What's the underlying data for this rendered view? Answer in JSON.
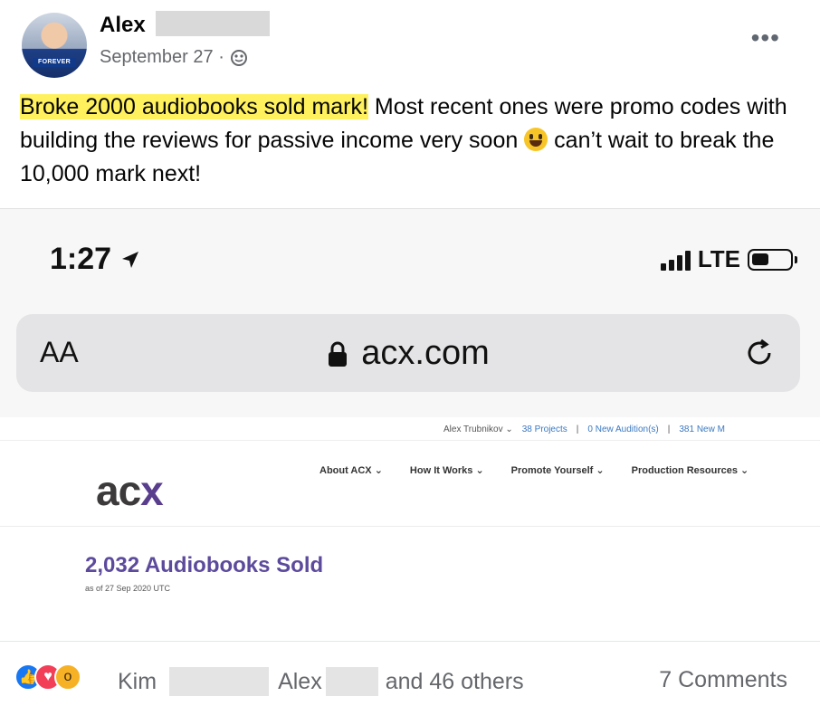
{
  "post": {
    "author": "Alex",
    "date": "September 27 ·",
    "avatar_banner": "FOREVER",
    "text_highlight": "Broke 2000 audiobooks sold mark!",
    "text_rest_1": " Most recent ones were promo codes with building the reviews for passive income very soon ",
    "text_rest_2": " can’t wait to break the 10,000 mark next!"
  },
  "phone": {
    "time": "1:27",
    "network": "LTE",
    "url_aa": "AA",
    "url": "acx.com"
  },
  "site": {
    "topbar_user": "Alex Trubnikov ⌄",
    "topbar_projects": "38 Projects",
    "topbar_auditions": "0 New Audition(s)",
    "topbar_messages": "381 New M",
    "logo_ac": "ac",
    "logo_x": "x",
    "nav": [
      "About ACX ⌄",
      "How It Works ⌄",
      "Promote Yourself ⌄",
      "Production Resources ⌄"
    ],
    "sold_title": "2,032 Audiobooks Sold",
    "sold_date": "as of 27 Sep 2020 UTC"
  },
  "reactions": {
    "name1": "Kim",
    "name2": "Alex",
    "others": "and 46 others",
    "comments": "7 Comments"
  },
  "icons": [
    "globe-icon",
    "more-icon",
    "location-arrow-icon",
    "signal-icon",
    "battery-icon",
    "lock-icon",
    "reload-icon",
    "like-reaction-icon",
    "love-reaction-icon",
    "wow-reaction-icon",
    "grinning-emoji-icon"
  ]
}
